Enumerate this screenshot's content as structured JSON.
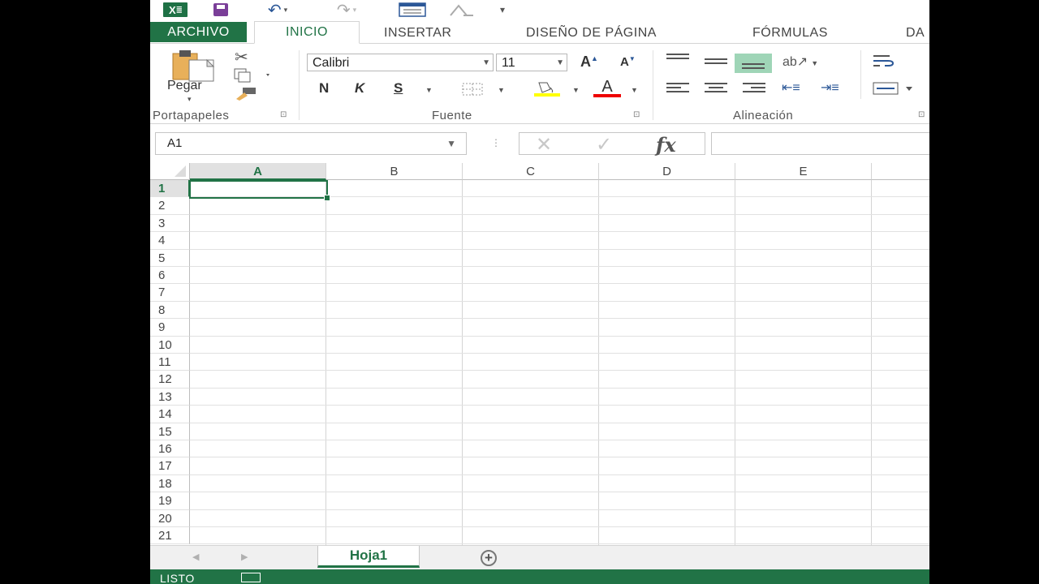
{
  "qat": {
    "excel_logo": "X",
    "logo_suffix": "≣",
    "more": "▾"
  },
  "tabs": [
    {
      "label": "ARCHIVO"
    },
    {
      "label": "INICIO"
    },
    {
      "label": "INSERTAR"
    },
    {
      "label": "DISEÑO DE PÁGINA"
    },
    {
      "label": "FÓRMULAS"
    },
    {
      "label": "DA"
    }
  ],
  "ribbon": {
    "clipboard": {
      "paste_label": "Pegar",
      "group_label": "Portapapeles"
    },
    "font": {
      "font_name": "Calibri",
      "font_size": "11",
      "bold": "N",
      "italic": "K",
      "underline": "S",
      "grow": "A",
      "shrink": "A",
      "font_color": "A",
      "group_label": "Fuente"
    },
    "alignment": {
      "group_label": "Alineación"
    }
  },
  "formula_bar": {
    "name_box": "A1",
    "fx": "fx",
    "value": ""
  },
  "grid": {
    "columns": [
      "A",
      "B",
      "C",
      "D",
      "E"
    ],
    "rows": [
      "1",
      "2",
      "3",
      "4",
      "5",
      "6",
      "7",
      "8",
      "9",
      "10",
      "11",
      "12",
      "13",
      "14",
      "15",
      "16",
      "17",
      "18",
      "19",
      "20",
      "21"
    ],
    "selected_cell": "A1"
  },
  "sheets": [
    {
      "name": "Hoja1"
    }
  ],
  "status": {
    "text": "LISTO"
  },
  "colors": {
    "accent": "#217346",
    "ribbon_highlight": "#9fd5b7"
  }
}
